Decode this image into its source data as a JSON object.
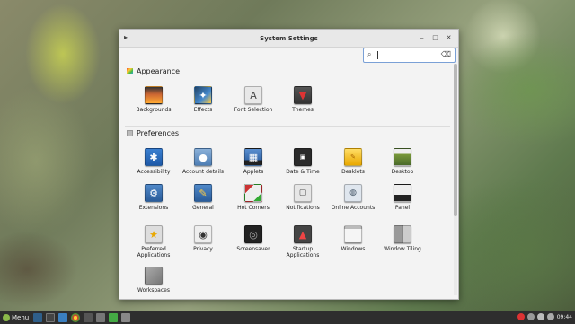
{
  "window": {
    "title": "System Settings",
    "search_value": ""
  },
  "sections": [
    {
      "title": "Appearance",
      "icon": "appearance-icon"
    },
    {
      "title": "Preferences",
      "icon": "preferences-icon"
    }
  ],
  "appearance_items": [
    {
      "label": "Backgrounds",
      "icon": "backgrounds-icon"
    },
    {
      "label": "Effects",
      "icon": "effects-icon"
    },
    {
      "label": "Font Selection",
      "icon": "font-selection-icon"
    },
    {
      "label": "Themes",
      "icon": "themes-icon"
    }
  ],
  "preferences_items": [
    {
      "label": "Accessibility",
      "icon": "accessibility-icon"
    },
    {
      "label": "Account details",
      "icon": "account-details-icon"
    },
    {
      "label": "Applets",
      "icon": "applets-icon"
    },
    {
      "label": "Date & Time",
      "icon": "date-time-icon"
    },
    {
      "label": "Desklets",
      "icon": "desklets-icon"
    },
    {
      "label": "Desktop",
      "icon": "desktop-icon"
    },
    {
      "label": "Extensions",
      "icon": "extensions-icon"
    },
    {
      "label": "General",
      "icon": "general-icon"
    },
    {
      "label": "Hot Corners",
      "icon": "hot-corners-icon"
    },
    {
      "label": "Notifications",
      "icon": "notifications-icon"
    },
    {
      "label": "Online Accounts",
      "icon": "online-accounts-icon"
    },
    {
      "label": "Panel",
      "icon": "panel-icon"
    },
    {
      "label": "Preferred Applications",
      "icon": "preferred-applications-icon"
    },
    {
      "label": "Privacy",
      "icon": "privacy-icon"
    },
    {
      "label": "Screensaver",
      "icon": "screensaver-icon"
    },
    {
      "label": "Startup Applications",
      "icon": "startup-applications-icon"
    },
    {
      "label": "Windows",
      "icon": "windows-icon"
    },
    {
      "label": "Window Tiling",
      "icon": "window-tiling-icon"
    },
    {
      "label": "Workspaces",
      "icon": "workspaces-icon"
    }
  ],
  "taskbar": {
    "menu_label": "Menu",
    "clock": "09:44"
  }
}
